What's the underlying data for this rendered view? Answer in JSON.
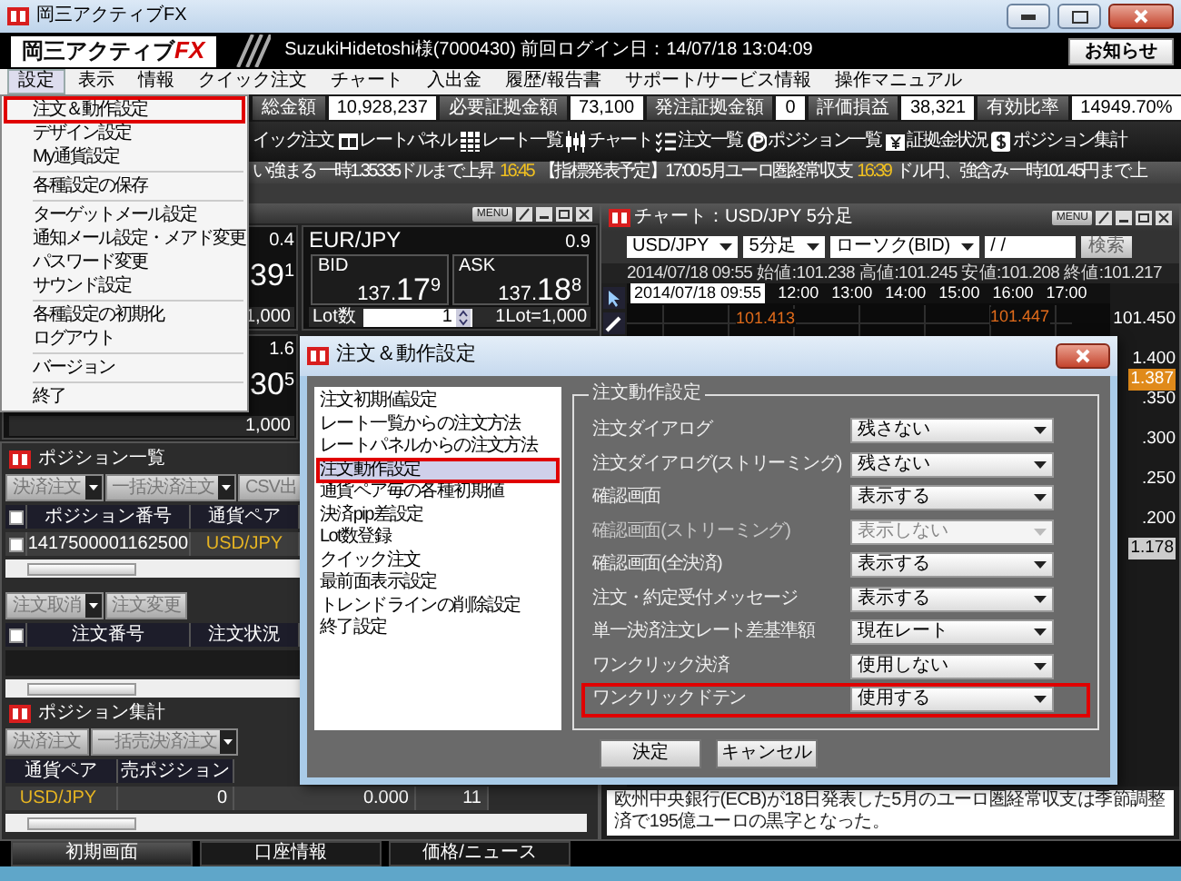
{
  "window": {
    "title": "岡三アクティブFX"
  },
  "header": {
    "logo_text": "岡三アクティブ",
    "logo_accent": "FX",
    "user_info": "SuzukiHidetoshi様(7000430)  前回ログイン日：14/07/18 13:04:09",
    "notice_button": "お知らせ"
  },
  "menu_bar": [
    {
      "label": "設定",
      "selected": true
    },
    {
      "label": "表示",
      "selected": false
    },
    {
      "label": "情報",
      "selected": false
    },
    {
      "label": "クイック注文",
      "selected": false
    },
    {
      "label": "チャート",
      "selected": false
    },
    {
      "label": "入出金",
      "selected": false
    },
    {
      "label": "履歴/報告書",
      "selected": false
    },
    {
      "label": "サポート/サービス情報",
      "selected": false
    },
    {
      "label": "操作マニュアル",
      "selected": false
    }
  ],
  "settings_menu": {
    "groups": [
      {
        "items": [
          {
            "label": "注文＆動作設定",
            "highlighted": true
          },
          {
            "label": "デザイン設定",
            "highlighted": false
          },
          {
            "label": "My通貨設定",
            "highlighted": false
          }
        ]
      },
      {
        "items": [
          {
            "label": "各種設定の保存",
            "highlighted": false
          }
        ]
      },
      {
        "items": [
          {
            "label": "ターゲットメール設定",
            "highlighted": false
          },
          {
            "label": "通知メール設定・メアド変更",
            "highlighted": false
          },
          {
            "label": "パスワード変更",
            "highlighted": false
          },
          {
            "label": "サウンド設定",
            "highlighted": false
          }
        ]
      },
      {
        "items": [
          {
            "label": "各種設定の初期化",
            "highlighted": false
          },
          {
            "label": "ログアウト",
            "highlighted": false
          }
        ]
      },
      {
        "items": [
          {
            "label": "バージョン",
            "highlighted": false
          }
        ]
      },
      {
        "items": [
          {
            "label": "終了",
            "highlighted": false
          }
        ]
      }
    ]
  },
  "account_summary": [
    {
      "label": "総金額",
      "value": "10,928,237"
    },
    {
      "label": "必要証拠金額",
      "value": "73,100"
    },
    {
      "label": "発注証拠金額",
      "value": "0"
    },
    {
      "label": "評価損益",
      "value": "38,321"
    },
    {
      "label": "有効比率",
      "value": "14949.70%"
    }
  ],
  "toolbar": [
    {
      "label": "イック注文",
      "kind": "text"
    },
    {
      "label": "レートパネル",
      "kind": "panel"
    },
    {
      "label": "レート一覧",
      "kind": "grid"
    },
    {
      "label": "チャート",
      "kind": "candles"
    },
    {
      "label": "注文一覧",
      "kind": "checklist"
    },
    {
      "label": "ポジション一覧",
      "kind": "p"
    },
    {
      "label": "証拠金状況",
      "kind": "yen"
    },
    {
      "label": "ポジション集計",
      "kind": "dollar"
    }
  ],
  "ticker": [
    {
      "kind": "news",
      "text": "い強まる 一時1.35335ドルまで上昇"
    },
    {
      "kind": "time",
      "text": "16:45"
    },
    {
      "kind": "news",
      "text": "【指標発表予定】17:00 5月ユーロ圏経常収支"
    },
    {
      "kind": "time",
      "text": "16:39"
    },
    {
      "kind": "news",
      "text": "ドル円、強含み 一時101.45円まで上"
    }
  ],
  "rate_area": {
    "menu_button": "MENU",
    "panels": [
      {
        "kind": "partial",
        "spread": "0.4",
        "price_big": "39",
        "price_small": "1",
        "lot_size": "1,000"
      },
      {
        "kind": "full",
        "pair": "EUR/JPY",
        "spread": "0.9",
        "bid_label": "BID",
        "bid": {
          "head": "137.",
          "big": "17",
          "small": "9"
        },
        "ask_label": "ASK",
        "ask": {
          "head": "137.",
          "big": "18",
          "small": "8"
        },
        "lot_label": "Lot数",
        "lot_value": "1",
        "lot_size": "1Lot=1,000"
      },
      {
        "kind": "partial",
        "spread": "1.6",
        "price_big": "30",
        "price_small": "5",
        "lot_size": "1,000"
      }
    ]
  },
  "positions": {
    "title": "ポジション一覧",
    "buttons": [
      {
        "label": "決済注文",
        "dropdown": true
      },
      {
        "label": "一括決済注文",
        "dropdown": true
      },
      {
        "label": "CSV出",
        "dropdown": false
      }
    ],
    "all_checked": false,
    "columns": [
      "ポジション番号",
      "通貨ペア"
    ],
    "rows": [
      {
        "checked": false,
        "cells": [
          "1417500001162500",
          "USD/JPY"
        ]
      }
    ]
  },
  "orders": {
    "buttons": [
      {
        "label": "注文取消",
        "dropdown": true
      },
      {
        "label": "注文変更",
        "dropdown": false
      }
    ],
    "all_checked": false,
    "columns": [
      "注文番号",
      "注文状況"
    ]
  },
  "position_summary": {
    "title": "ポジション集計",
    "buttons": [
      {
        "label": "決済注文",
        "dropdown": false
      },
      {
        "label": "一括売決済注文",
        "dropdown": true
      }
    ],
    "columns": [
      "通貨ペア",
      "売ポジション"
    ],
    "rows": [
      [
        "USD/JPY",
        "0",
        "0.000",
        "11"
      ]
    ]
  },
  "chart_panel": {
    "title": "チャート：USD/JPY 5分足",
    "menu_button": "MENU",
    "controls": [
      {
        "kind": "select",
        "value": "USD/JPY"
      },
      {
        "kind": "select",
        "value": "5分足"
      },
      {
        "kind": "select",
        "value": "ローソク(BID)"
      },
      {
        "kind": "date",
        "value": "/ /"
      },
      {
        "kind": "button",
        "value": "検索"
      }
    ],
    "ohlc": "2014/07/18 09:55 始値:101.238 高値:101.245 安値:101.208 終値:101.217",
    "cursor_time": "2014/07/18 09:55",
    "time_labels": [
      "12:00",
      "13:00",
      "14:00",
      "15:00",
      "16:00",
      "17:00"
    ],
    "price_labels": [
      "101.450",
      "1.400",
      ".350",
      ".300",
      ".250",
      ".200"
    ],
    "current_price": "1.387",
    "low_price": "1.178",
    "markers": [
      "101.413",
      "101.447"
    ],
    "news": "欧州中央銀行(ECB)が18日発表した5月のユーロ圏経常収支は季節調整済で195億ユーロの黒字となった。"
  },
  "dialog": {
    "title": "注文＆動作設定",
    "categories": [
      {
        "label": "注文初期値設定",
        "selected": false,
        "highlighted": false
      },
      {
        "label": "レート一覧からの注文方法",
        "selected": false,
        "highlighted": false
      },
      {
        "label": "レートパネルからの注文方法",
        "selected": false,
        "highlighted": false
      },
      {
        "label": "注文動作設定",
        "selected": true,
        "highlighted": true
      },
      {
        "label": "通貨ペア毎の各種初期値",
        "selected": false,
        "highlighted": false
      },
      {
        "label": "決済pip差設定",
        "selected": false,
        "highlighted": false
      },
      {
        "label": "Lot数登録",
        "selected": false,
        "highlighted": false
      },
      {
        "label": "クイック注文",
        "selected": false,
        "highlighted": false
      },
      {
        "label": "最前面表示設定",
        "selected": false,
        "highlighted": false
      },
      {
        "label": "トレンドラインの削除設定",
        "selected": false,
        "highlighted": false
      },
      {
        "label": "終了設定",
        "selected": false,
        "highlighted": false
      }
    ],
    "group_title": "注文動作設定",
    "settings": [
      {
        "label": "注文ダイアログ",
        "value": "残さない",
        "disabled": false,
        "highlighted": false
      },
      {
        "label": "注文ダイアログ(ストリーミング)",
        "value": "残さない",
        "disabled": false,
        "highlighted": false
      },
      {
        "label": "確認画面",
        "value": "表示する",
        "disabled": false,
        "highlighted": false
      },
      {
        "label": "確認画面(ストリーミング)",
        "value": "表示しない",
        "disabled": true,
        "highlighted": false
      },
      {
        "label": "確認画面(全決済)",
        "value": "表示する",
        "disabled": false,
        "highlighted": false
      },
      {
        "label": "注文・約定受付メッセージ",
        "value": "表示する",
        "disabled": false,
        "highlighted": false
      },
      {
        "label": "単一決済注文レート差基準額",
        "value": "現在レート",
        "disabled": false,
        "highlighted": false
      },
      {
        "label": "ワンクリック決済",
        "value": "使用しない",
        "disabled": false,
        "highlighted": false
      },
      {
        "label": "ワンクリックドテン",
        "value": "使用する",
        "disabled": false,
        "highlighted": true
      }
    ],
    "buttons": [
      "決定",
      "キャンセル"
    ]
  },
  "bottom_tabs": [
    {
      "label": "初期画面",
      "selected": true
    },
    {
      "label": "口座情報",
      "selected": false
    },
    {
      "label": "価格/ニュース",
      "selected": false
    }
  ]
}
